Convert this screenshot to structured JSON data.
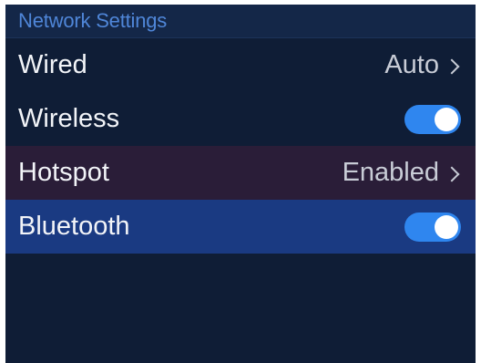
{
  "header": {
    "title": "Network Settings"
  },
  "rows": [
    {
      "label": "Wired",
      "value": "Auto",
      "control": "chevron"
    },
    {
      "label": "Wireless",
      "control": "toggle",
      "on": true
    },
    {
      "label": "Hotspot",
      "value": "Enabled",
      "control": "chevron"
    },
    {
      "label": "Bluetooth",
      "control": "toggle",
      "on": true
    }
  ],
  "colors": {
    "background": "#0f1d36",
    "header_text": "#4f86d8",
    "toggle_on": "#2f86ef",
    "hotspot_highlight": "#2a1d38",
    "selected_row": "#1a3a82"
  }
}
